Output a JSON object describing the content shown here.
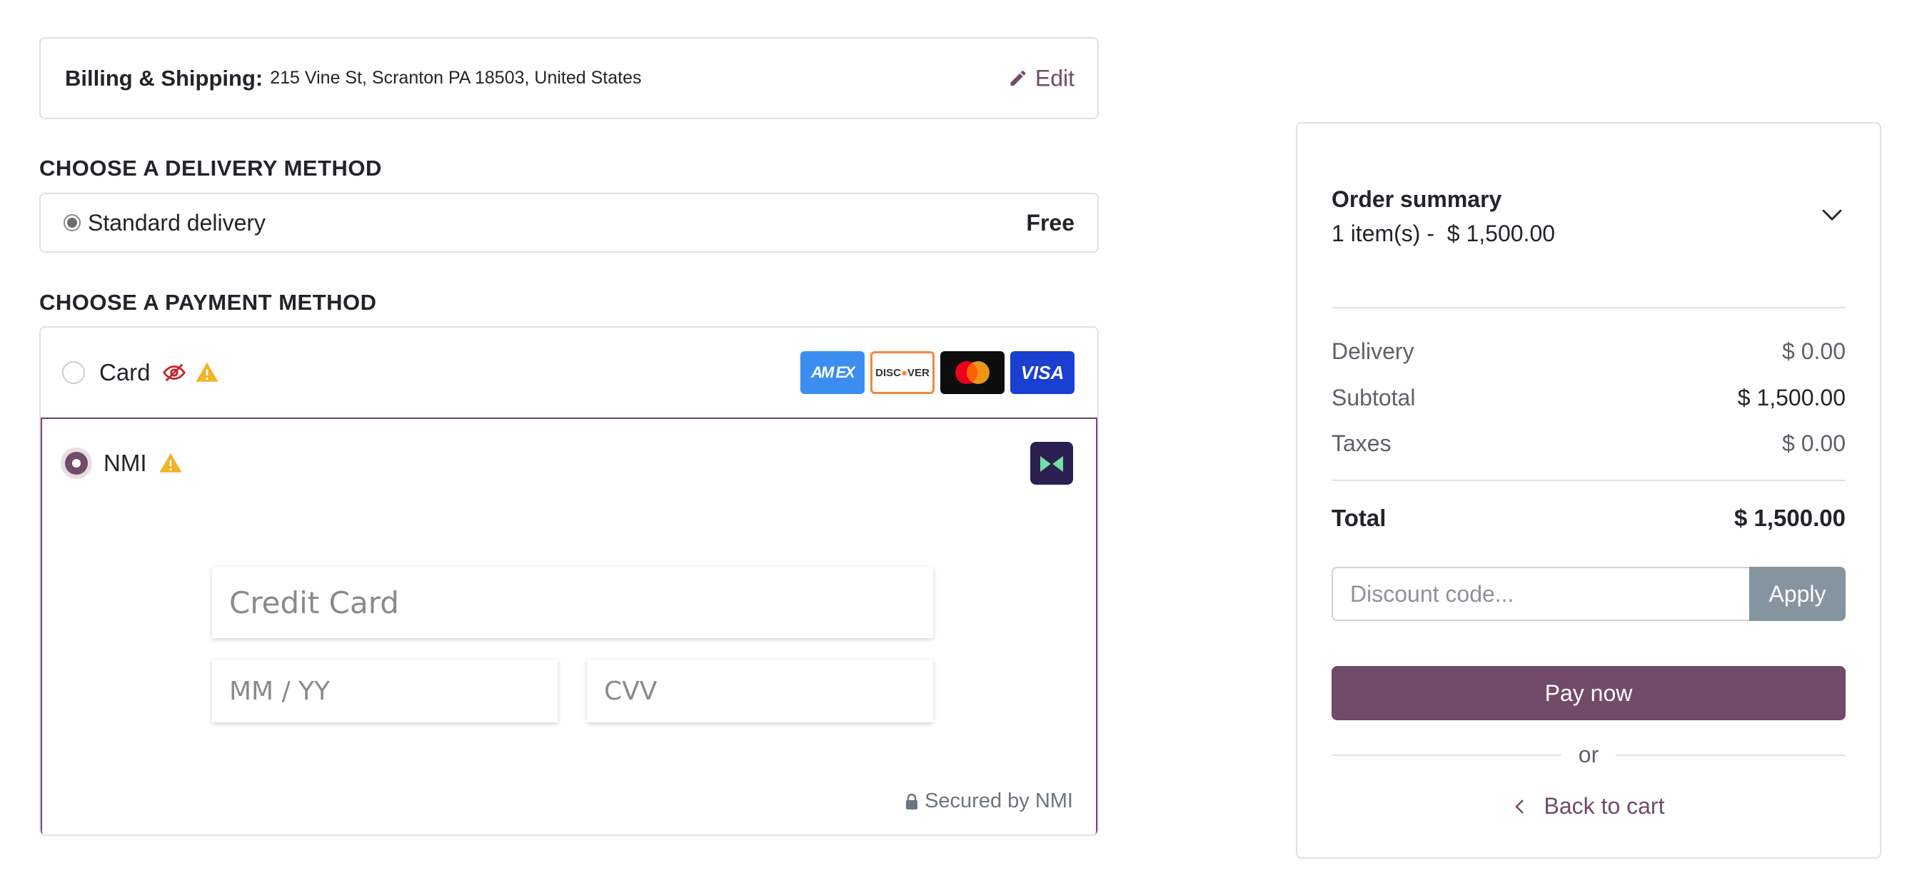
{
  "billing": {
    "title": "Billing & Shipping:",
    "address": "215 Vine St, Scranton PA 18503, United States",
    "edit_label": "Edit"
  },
  "delivery": {
    "heading": "CHOOSE A DELIVERY METHOD",
    "option_label": "Standard delivery",
    "option_price": "Free",
    "selected": true
  },
  "payment": {
    "heading": "CHOOSE A PAYMENT METHOD",
    "methods": [
      {
        "label": "Card",
        "selected": false,
        "icons": [
          "eye-slash-icon",
          "warning-icon"
        ],
        "logos": [
          "AMEX",
          "DISCOVER",
          "mastercard",
          "VISA"
        ]
      },
      {
        "label": "NMI",
        "selected": true,
        "icons": [
          "warning-icon"
        ]
      }
    ],
    "nmi_form": {
      "card_placeholder": "Credit Card",
      "expiry_placeholder": "MM / YY",
      "cvv_placeholder": "CVV",
      "secured_text": "Secured by NMI"
    }
  },
  "summary": {
    "title": "Order summary",
    "item_count": "1 item(s) -",
    "item_total": "$ 1,500.00",
    "lines": [
      {
        "label": "Delivery",
        "value": "$ 0.00"
      },
      {
        "label": "Subtotal",
        "value": "$ 1,500.00"
      },
      {
        "label": "Taxes",
        "value": "$ 0.00"
      }
    ],
    "total_label": "Total",
    "total_value": "$ 1,500.00",
    "discount_placeholder": "Discount code...",
    "apply_label": "Apply",
    "pay_label": "Pay now",
    "or_label": "or",
    "back_label": "Back to cart"
  },
  "colors": {
    "brand": "#714b67",
    "apply_button": "#8595a0",
    "warning": "#f0b429",
    "eye_icon": "#c0282d"
  }
}
